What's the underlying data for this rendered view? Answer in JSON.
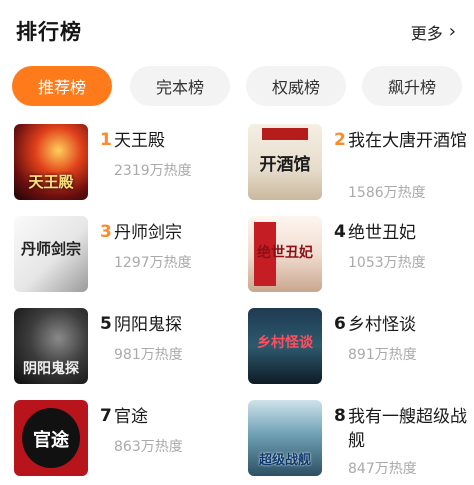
{
  "header": {
    "title": "排行榜",
    "more_label": "更多",
    "more_icon": "chevron-right-icon"
  },
  "tabs": [
    {
      "label": "推荐榜",
      "active": true
    },
    {
      "label": "完本榜",
      "active": false
    },
    {
      "label": "权威榜",
      "active": false
    },
    {
      "label": "飙升榜",
      "active": false
    }
  ],
  "books": [
    {
      "rank": "1",
      "name": "天王殿",
      "heat": "2319万热度",
      "cover_text": "天王殿"
    },
    {
      "rank": "2",
      "name": "我在大唐开酒馆",
      "heat": "1586万热度",
      "cover_text": "开酒馆"
    },
    {
      "rank": "3",
      "name": "丹师剑宗",
      "heat": "1297万热度",
      "cover_text": "丹师剑宗"
    },
    {
      "rank": "4",
      "name": "绝世丑妃",
      "heat": "1053万热度",
      "cover_text": "绝世丑妃"
    },
    {
      "rank": "5",
      "name": "阴阳鬼探",
      "heat": "981万热度",
      "cover_text": "阴阳鬼探"
    },
    {
      "rank": "6",
      "name": "乡村怪谈",
      "heat": "891万热度",
      "cover_text": "乡村怪谈"
    },
    {
      "rank": "7",
      "name": "官途",
      "heat": "863万热度",
      "cover_text": "官途"
    },
    {
      "rank": "8",
      "name": "我有一艘超级战舰",
      "heat": "847万热度",
      "cover_text": "超级战舰"
    }
  ],
  "colors": {
    "accent": "#ff7a1a",
    "rank_top": "#ff8a2a",
    "heat_text": "#aaaaaa",
    "tab_bg": "#f3f3f3"
  }
}
